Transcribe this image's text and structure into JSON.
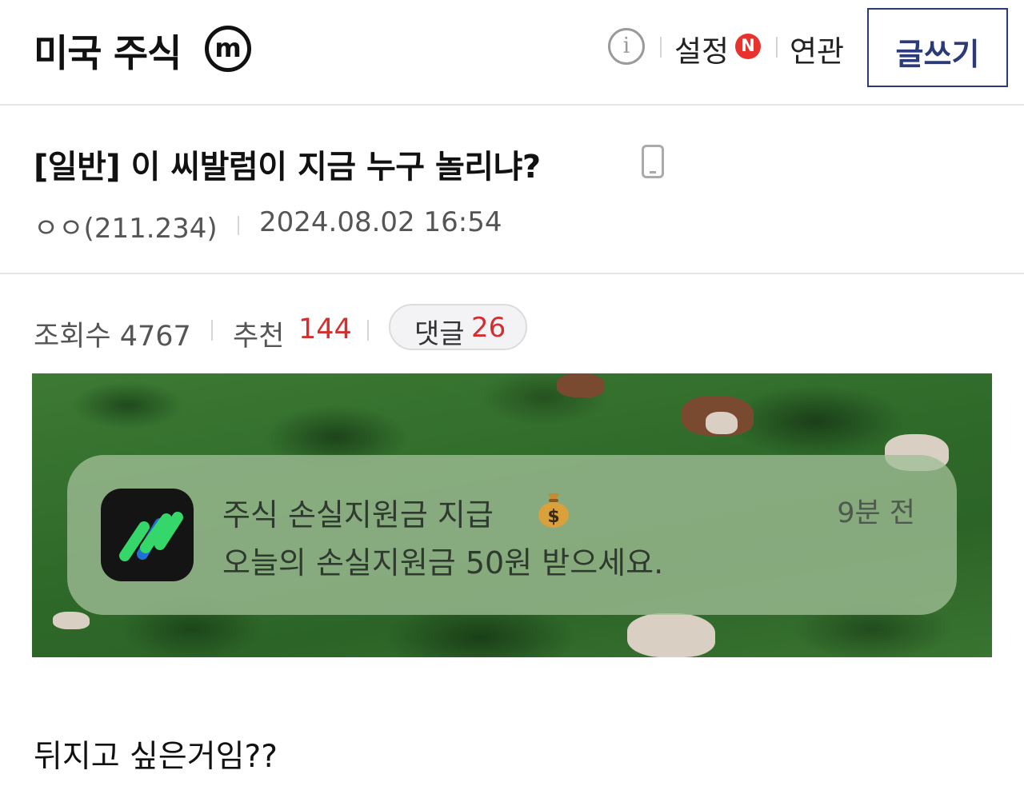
{
  "header": {
    "gallery_title": "미국 주식",
    "gallery_badge": "m",
    "info_label": "i",
    "settings_label": "설정",
    "new_badge": "N",
    "related_label": "연관",
    "write_label": "글쓰기"
  },
  "post": {
    "title": "[일반] 이 씨발럼이 지금 누구 놀리냐?",
    "author": "ㅇㅇ(211.234)",
    "date": "2024.08.02 16:54",
    "views_label": "조회수 4767",
    "recommend_label": "추천",
    "recommend_count": "144",
    "comment_label": "댓글",
    "comment_count": "26",
    "body": "뒤지고 싶은거임??"
  },
  "notification": {
    "title": "주식 손실지원금 지급",
    "time": "9분 전",
    "message": "오늘의 손실지원금 50원 받으세요."
  },
  "icons": {
    "gallery_badge": "minor-gallery-badge-icon",
    "info": "info-icon",
    "new": "new-badge-icon",
    "phone": "mobile-phone-icon",
    "app": "stock-app-icon",
    "money": "money-bag-icon"
  },
  "colors": {
    "accent_navy": "#2b3a78",
    "count_red": "#d32f2f",
    "new_badge_red": "#e8322d"
  }
}
